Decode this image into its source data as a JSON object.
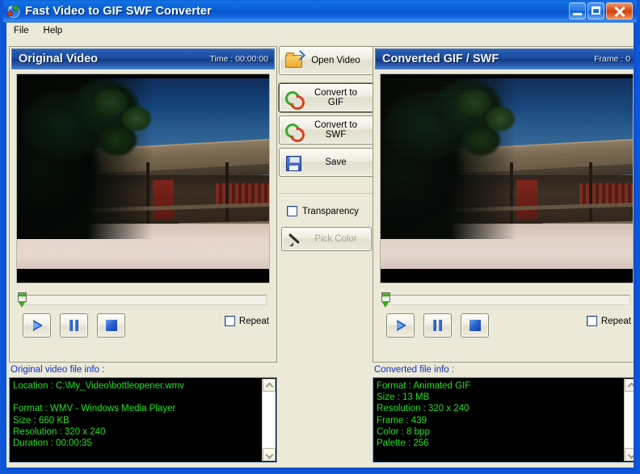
{
  "window": {
    "title": "Fast Video to GIF SWF Converter",
    "icon": "media-converter-icon",
    "caption_buttons": {
      "minimize": "minimize-icon",
      "maximize": "maximize-icon",
      "close": "close-icon"
    }
  },
  "menu": {
    "items": [
      {
        "label": "File"
      },
      {
        "label": "Help"
      }
    ]
  },
  "left_panel": {
    "title": "Original Video",
    "meta_label": "Time : 00:00:00",
    "slider_value": 0,
    "controls": {
      "play": "play-icon",
      "pause": "pause-icon",
      "stop": "stop-icon"
    },
    "repeat": {
      "label": "Repeat",
      "checked": false
    }
  },
  "right_panel": {
    "title": "Converted GIF / SWF",
    "meta_label": "Frame : 0",
    "slider_value": 0,
    "controls": {
      "play": "play-icon",
      "pause": "pause-icon",
      "stop": "stop-icon"
    },
    "repeat": {
      "label": "Repeat",
      "checked": false
    }
  },
  "center": {
    "open_video": {
      "label": "Open Video",
      "icon": "open-folder-icon"
    },
    "convert_gif": {
      "label": "Convert to GIF",
      "icon": "convert-arrows-icon",
      "focused": true
    },
    "convert_swf": {
      "label": "Convert to SWF",
      "icon": "convert-arrows-icon"
    },
    "save": {
      "label": "Save",
      "icon": "floppy-disk-icon"
    },
    "transparency": {
      "label": "Transparency",
      "checked": false
    },
    "pick_color": {
      "label": "Pick Color",
      "icon": "eyedropper-icon",
      "disabled": true
    }
  },
  "info_left": {
    "label": "Original video file info :",
    "text": "Location : C:\\My_Video\\bottleopener.wmv\n\nFormat : WMV - Windows Media Player\nSize : 660 KB\nResolution : 320 x 240\nDuration : 00:00:35"
  },
  "info_right": {
    "label": "Converted file info :",
    "text": "Format : Animated GIF\nSize : 13 MB\nResolution : 320 x 240\nFrame : 439\nColor : 8 bpp\nPalette : 256"
  },
  "colors": {
    "window_border": "#0f56d8",
    "titlebar_blue": "#0b55ce",
    "client_bg": "#ece9d8",
    "panel_header_blue": "#1a4a9d",
    "info_label_blue": "#0a33c4",
    "console_bg": "#000000",
    "console_text": "#22e024",
    "slider_thumb_green": "#4aa02e",
    "transport_glyph_blue": "#1b54c8"
  }
}
